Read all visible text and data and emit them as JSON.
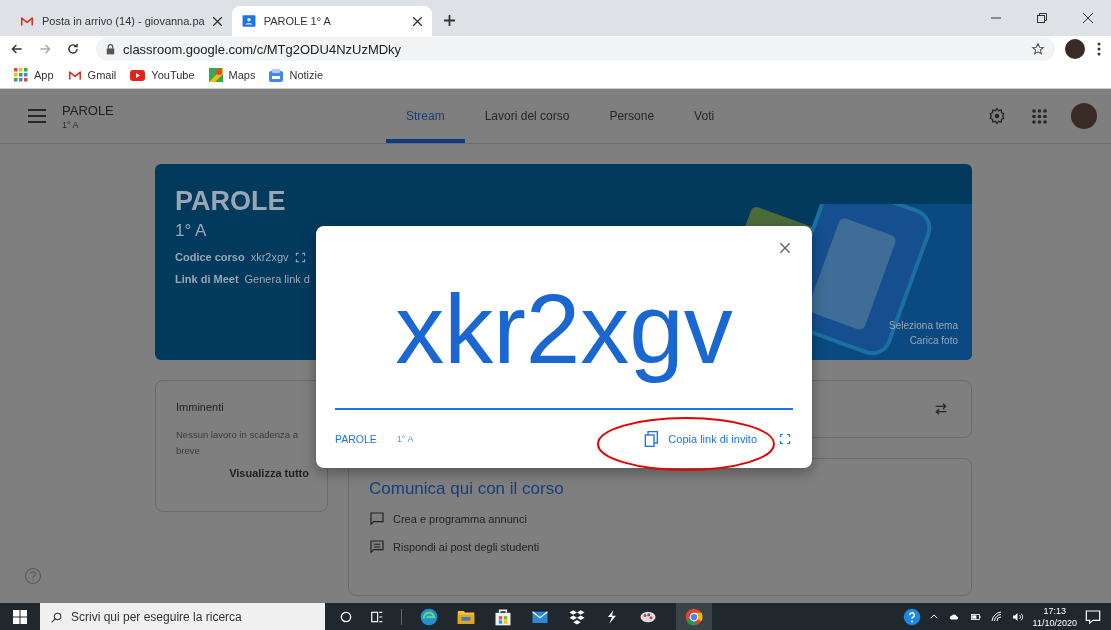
{
  "browser": {
    "tabs": [
      {
        "title": "Posta in arrivo (14) - giovanna.pa",
        "kind": "mail",
        "selected": false
      },
      {
        "title": "PAROLE 1° A",
        "kind": "classroom",
        "selected": true
      }
    ],
    "address": "classroom.google.com/c/MTg2ODU4NzUzMDky",
    "bookmarks": [
      {
        "label": "App",
        "kind": "apps"
      },
      {
        "label": "Gmail",
        "kind": "mail"
      },
      {
        "label": "YouTube",
        "kind": "video"
      },
      {
        "label": "Maps",
        "kind": "map"
      },
      {
        "label": "Notizie",
        "kind": "news"
      }
    ]
  },
  "classroom": {
    "class_name": "PAROLE",
    "section": "1° A",
    "tabs": [
      {
        "label": "Stream",
        "selected": true
      },
      {
        "label": "Lavori del corso",
        "selected": false
      },
      {
        "label": "Persone",
        "selected": false
      },
      {
        "label": "Voti",
        "selected": false
      }
    ],
    "banner": {
      "title": "PAROLE",
      "section": "1° A",
      "details": [
        {
          "label": "Codice corso",
          "value": "xkr2xgv",
          "kind": "code"
        },
        {
          "label": "Link di Meet",
          "value": "Genera link d",
          "kind": "meet"
        }
      ],
      "actions": [
        "Seleziona tema",
        "Carica foto"
      ]
    },
    "upcoming": {
      "title": "Imminenti",
      "text": "Nessun lavoro in scadenza a breve",
      "link": "Visualizza tutto"
    },
    "stream": {
      "prompt": "Comunica qui con il corso",
      "items": [
        {
          "text": "Crea e programma annunci",
          "kind": "create"
        },
        {
          "text": "Rispondi ai post degli studenti",
          "kind": "reply"
        }
      ]
    }
  },
  "dialog": {
    "code": "xkr2xgv",
    "class_name": "PAROLE",
    "section": "1° A",
    "copy_link": "Copia link di invito"
  },
  "taskbar": {
    "search_placeholder": "Scrivi qui per eseguire la ricerca",
    "time": "17:13",
    "date": "11/10/2020"
  }
}
